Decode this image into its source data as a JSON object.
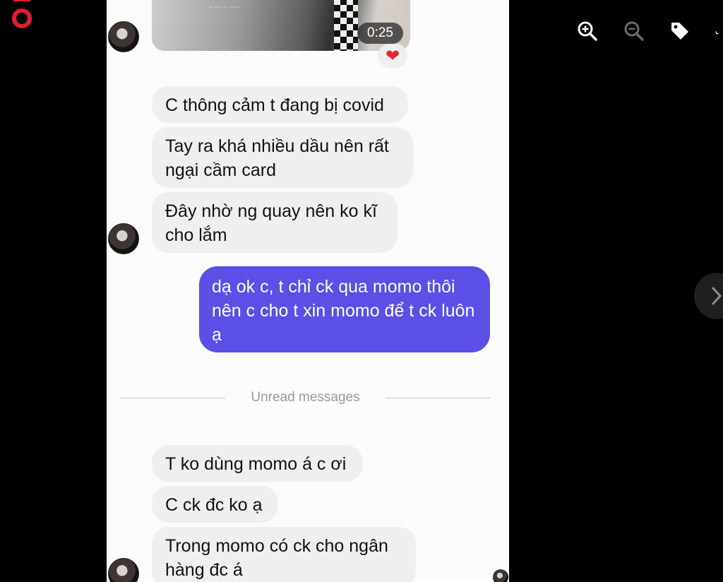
{
  "video": {
    "duration": "0:25",
    "reaction": "❤"
  },
  "messages_incoming_1": [
    "C thông cảm t đang bị covid",
    "Tay ra khá nhiều dầu nên rất ngại cầm card",
    "Đây nhờ ng quay nên ko kĩ cho lắm"
  ],
  "message_outgoing": "dạ ok c, t chỉ ck qua momo thôi nên c cho t xin momo để t ck luôn ạ",
  "divider_label": "Unread messages",
  "messages_incoming_2": [
    "T ko dùng momo á c ơi",
    "C ck đc ko ạ",
    "Trong momo có ck cho ngân hàng đc á"
  ],
  "toolbar": {
    "zoom_in": "zoom-in-icon",
    "zoom_out": "zoom-out-icon",
    "tag": "tag-icon"
  },
  "colors": {
    "outgoing_bubble": "#5b4fe6",
    "incoming_bubble": "#efefef",
    "brand_logo": "#e11d2e"
  }
}
